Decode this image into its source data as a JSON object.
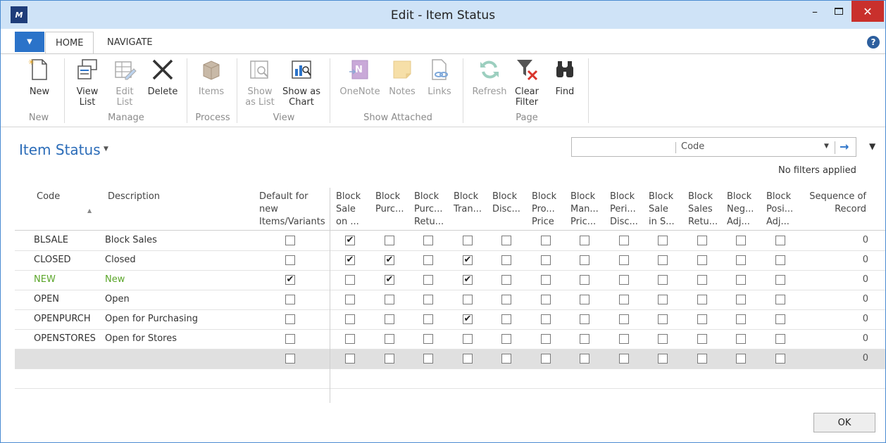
{
  "window": {
    "logo": "M",
    "title": "Edit - Item Status",
    "minimize": "–",
    "close": "✕"
  },
  "tabs": {
    "file": "▼",
    "home": "HOME",
    "navigate": "NAVIGATE",
    "help": "?"
  },
  "ribbon": {
    "new": "New",
    "view_list": "View\nList",
    "edit_list": "Edit\nList",
    "delete": "Delete",
    "items": "Items",
    "show_as_list": "Show\nas List",
    "show_as_chart": "Show as\nChart",
    "onenote": "OneNote",
    "notes": "Notes",
    "links": "Links",
    "refresh": "Refresh",
    "clear_filter": "Clear\nFilter",
    "find": "Find",
    "groups": {
      "new": "New",
      "manage": "Manage",
      "process": "Process",
      "view": "View",
      "show_attached": "Show Attached",
      "page": "Page"
    }
  },
  "page": {
    "title": "Item Status",
    "search_field": "Code",
    "search_value": "",
    "filter_note": "No filters applied",
    "ok": "OK"
  },
  "columns": {
    "code": "Code",
    "description": "Description",
    "default": "Default for\nnew\nItems/Variants",
    "block_headers": [
      "Block\nSale\non ...",
      "Block\nPurc...",
      "Block\nPurc...\nRetu...",
      "Block\nTran...",
      "Block\nDisc...",
      "Block\nPro...\nPrice",
      "Block\nMan...\nPric...",
      "Block\nPeri...\nDisc...",
      "Block\nSale\nin S...",
      "Block\nSales\nRetu...",
      "Block\nNeg...\nAdj...",
      "Block\nPosi...\nAdj..."
    ],
    "sequence": "Sequence of\nRecord",
    "sort_indicator": "▲"
  },
  "rows": [
    {
      "code": "BLSALE",
      "description": "Block Sales",
      "default": false,
      "blocks": [
        true,
        false,
        false,
        false,
        false,
        false,
        false,
        false,
        false,
        false,
        false,
        false
      ],
      "seq": "0",
      "highlight": false,
      "selected": false
    },
    {
      "code": "CLOSED",
      "description": "Closed",
      "default": false,
      "blocks": [
        true,
        true,
        false,
        true,
        false,
        false,
        false,
        false,
        false,
        false,
        false,
        false
      ],
      "seq": "0",
      "highlight": false,
      "selected": false
    },
    {
      "code": "NEW",
      "description": "New",
      "default": true,
      "blocks": [
        false,
        true,
        false,
        true,
        false,
        false,
        false,
        false,
        false,
        false,
        false,
        false
      ],
      "seq": "0",
      "highlight": true,
      "selected": false
    },
    {
      "code": "OPEN",
      "description": "Open",
      "default": false,
      "blocks": [
        false,
        false,
        false,
        false,
        false,
        false,
        false,
        false,
        false,
        false,
        false,
        false
      ],
      "seq": "0",
      "highlight": false,
      "selected": false
    },
    {
      "code": "OPENPURCH",
      "description": "Open for Purchasing",
      "default": false,
      "blocks": [
        false,
        false,
        false,
        true,
        false,
        false,
        false,
        false,
        false,
        false,
        false,
        false
      ],
      "seq": "0",
      "highlight": false,
      "selected": false
    },
    {
      "code": "OPENSTORES",
      "description": "Open for Stores",
      "default": false,
      "blocks": [
        false,
        false,
        false,
        false,
        false,
        false,
        false,
        false,
        false,
        false,
        false,
        false
      ],
      "seq": "0",
      "highlight": false,
      "selected": false
    },
    {
      "code": "",
      "description": "",
      "default": false,
      "blocks": [
        false,
        false,
        false,
        false,
        false,
        false,
        false,
        false,
        false,
        false,
        false,
        false
      ],
      "seq": "0",
      "highlight": false,
      "selected": true
    }
  ],
  "colors": {
    "accent": "#2b73c9",
    "title_blue": "#2b6cb8",
    "highlight_green": "#5ba62a",
    "close_red": "#c9302c"
  }
}
